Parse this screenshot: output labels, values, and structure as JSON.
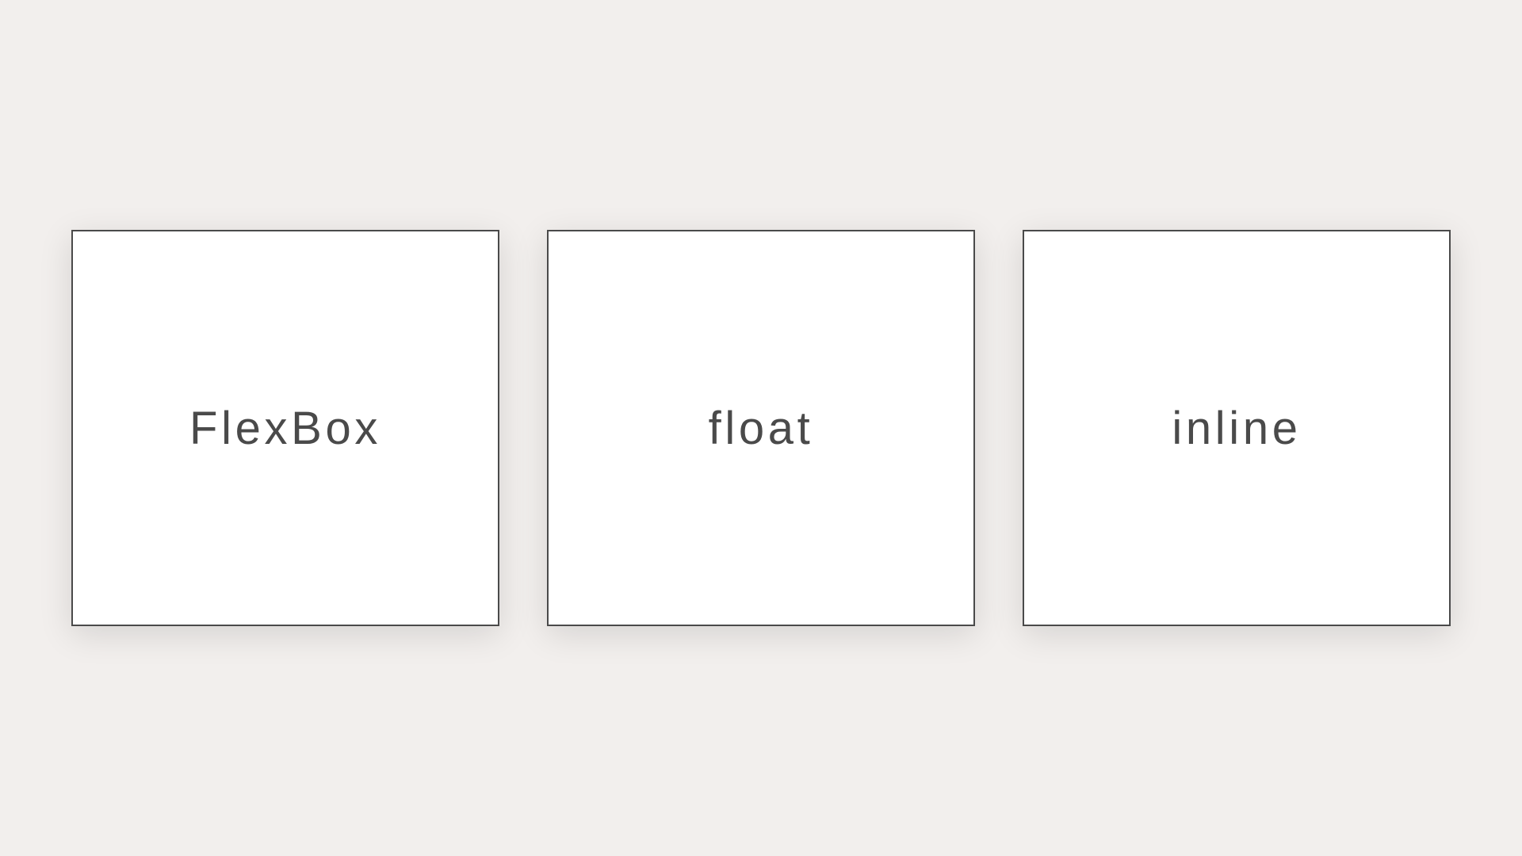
{
  "cards": [
    {
      "label": "FlexBox"
    },
    {
      "label": "float"
    },
    {
      "label": "inline"
    }
  ]
}
